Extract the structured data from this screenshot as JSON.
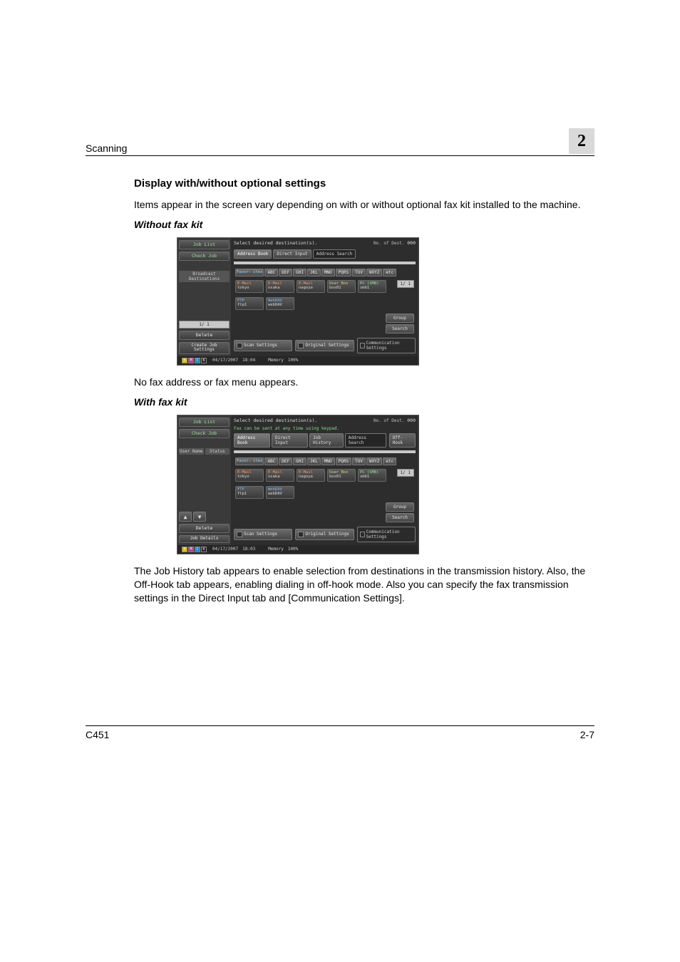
{
  "header": {
    "section": "Scanning",
    "chapter": "2"
  },
  "text": {
    "h1": "Display with/without optional settings",
    "p1": "Items appear in the screen vary depending on with or without optional fax kit installed to the machine.",
    "sub1": "Without fax kit",
    "p2": "No fax address or fax menu appears.",
    "sub2": "With fax kit",
    "p3": "The Job History tab appears to enable selection from destinations in the transmission history. Also, the Off-Hook tab appears, enabling dialing in off-hook mode. Also you can specify the fax transmission settings in the Direct Input tab and [Communication Settings]."
  },
  "panel_labels": {
    "joblist": "Job List",
    "checkjob": "Check Job",
    "broadcast": "Broadcast\nDestinations",
    "delete": "Delete",
    "createjob": "Create Job\nSettings",
    "jobdetails": "Job Details",
    "username": "User\nName",
    "status": "Status",
    "page": "1/  1",
    "sel_dest": "Select desired destination(s).",
    "noscan_label": "No. of\nDest.",
    "noscan_val": "000",
    "hint": "Fax can be sent at any time using keypad.",
    "tabs": {
      "addr": "Address Book",
      "direct": "Direct Input",
      "jobhx": "Job History",
      "addrsearch": "Address\nSearch",
      "offhook": "Off-Hook"
    },
    "keys": [
      "Favor-\nites",
      "ABC",
      "DEF",
      "GHI",
      "JKL",
      "MNO",
      "PQRS",
      "TUV",
      "WXYZ",
      "etc"
    ],
    "tiles": [
      {
        "l1": "E-Mail",
        "l2": "tokyo",
        "cls": ""
      },
      {
        "l1": "E-Mail",
        "l2": "osaka",
        "cls": ""
      },
      {
        "l1": "E-Mail",
        "l2": "nagoya",
        "cls": ""
      },
      {
        "l1": "User Box",
        "l2": "box01",
        "cls": "yel"
      },
      {
        "l1": "PC (SMB)",
        "l2": "smb1",
        "cls": "grn"
      }
    ],
    "tiles2": [
      {
        "l1": "FTP",
        "l2": "ftp1",
        "cls": "blue"
      },
      {
        "l1": "WebDAV",
        "l2": "webDAV",
        "cls": "blue"
      }
    ],
    "tilepage": "1/  1",
    "group": "Group",
    "search": "Search",
    "scansettings": "Scan Settings",
    "origsettings": "Original Settings",
    "commsettings": "Communication\nSettings",
    "status_date1": "04/17/2007",
    "status_time1": "18:04",
    "status_date2": "04/17/2007",
    "status_time2": "18:03",
    "memory": "Memory",
    "memval": "100%",
    "toner": [
      "Y",
      "M",
      "C",
      "K"
    ]
  },
  "footer": {
    "left": "C451",
    "right": "2-7"
  }
}
